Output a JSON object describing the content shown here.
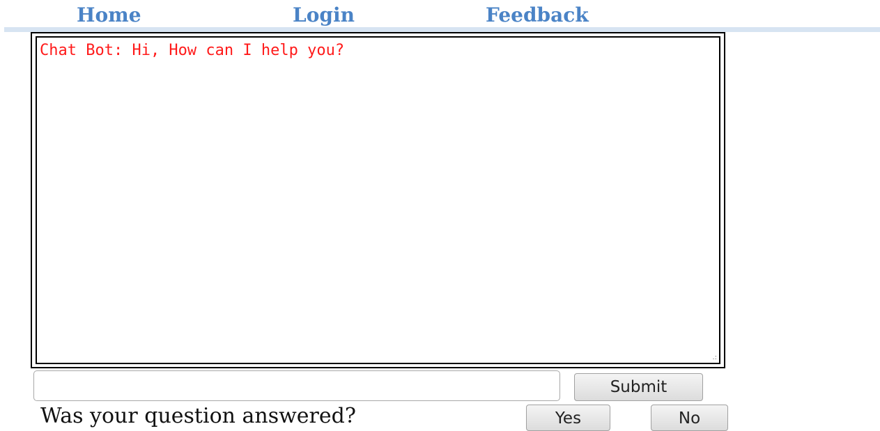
{
  "nav": {
    "home_label": "Home",
    "login_label": "Login",
    "feedback_label": "Feedback",
    "link_color": "#4a83c6",
    "bar_color": "#d7e4f2"
  },
  "chat": {
    "message": "Chat Bot: Hi, How can I help you?",
    "message_color": "#ff1a1a",
    "resize_grip": ".:"
  },
  "input": {
    "value": "",
    "placeholder": ""
  },
  "submit_label": "Submit",
  "feedback_prompt": {
    "question": "Was your question answered?",
    "yes_label": "Yes",
    "no_label": "No"
  }
}
